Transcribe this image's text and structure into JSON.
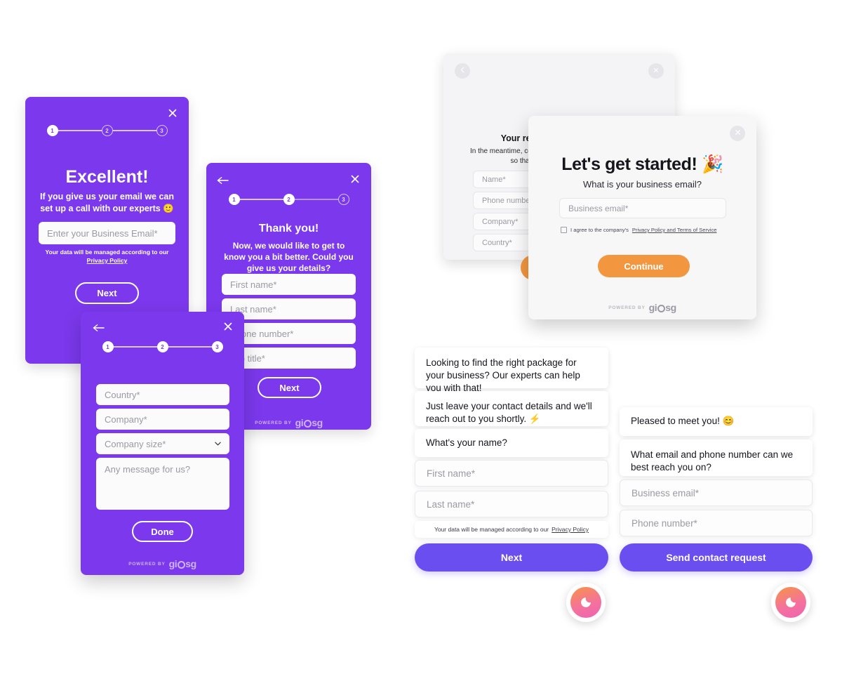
{
  "brand": {
    "purple": "#7b38ec",
    "indigo": "#6b4ef0",
    "orange": "#f2973f",
    "powered_by": "POWERED BY",
    "logo_g1": "gi",
    "logo_g2": "sg"
  },
  "card_excellent": {
    "name": "excellent-card",
    "close_icon": "close-icon",
    "steps": [
      {
        "label": "1",
        "state": "active"
      },
      {
        "label": "2",
        "state": "idle"
      },
      {
        "label": "3",
        "state": "idle"
      }
    ],
    "title": "Excellent!",
    "subtitle": "If you give us your email we can set up a call with our experts 🙂",
    "email_placeholder": "Enter your Business Email*",
    "privacy_text": "Your data will be managed according to our",
    "privacy_link": "Privacy Policy",
    "button_label": "Next"
  },
  "card_thankyou": {
    "name": "thank-you-card",
    "back_icon": "arrow-left-icon",
    "close_icon": "close-icon",
    "steps": [
      {
        "label": "1",
        "state": "active"
      },
      {
        "label": "2",
        "state": "active"
      },
      {
        "label": "3",
        "state": "idle"
      }
    ],
    "title": "Thank you!",
    "subtitle": "Now, we would like to get to know you a bit better. Could you give us your details?",
    "fields": [
      "First name*",
      "Last name*",
      "Phone number*",
      "Job title*"
    ],
    "button_label": "Next"
  },
  "card_details": {
    "name": "company-details-card",
    "back_icon": "arrow-left-icon",
    "close_icon": "close-icon",
    "steps": [
      {
        "label": "1",
        "state": "active"
      },
      {
        "label": "2",
        "state": "active"
      },
      {
        "label": "3",
        "state": "active"
      }
    ],
    "fields": [
      "Country*",
      "Company*"
    ],
    "select_placeholder": "Company size*",
    "select_icon": "chevron-down-icon",
    "textarea_placeholder": "Any message for us?",
    "button_label": "Done"
  },
  "card_request_sent": {
    "name": "request-sent-card",
    "back_icon": "arrow-left-icon",
    "close_icon": "close-icon",
    "title": "Your request has been sent.",
    "subtitle": "In the meantime, could you give us a bit more information so that we can help you better?",
    "fields": [
      "Name*",
      "Phone number*",
      "Company*",
      "Country*"
    ]
  },
  "card_get_started": {
    "name": "get-started-card",
    "close_icon": "close-icon",
    "title": "Let's get started! 🎉",
    "subtitle": "What is your business email?",
    "email_placeholder": "Business email*",
    "consent_text": "I agree to the company's",
    "consent_link": "Privacy Policy and Terms of Service",
    "button_label": "Continue"
  },
  "chat_left": {
    "name": "chat-widget-name-step",
    "close_icon": "close-icon",
    "messages": [
      "Looking to find the right package for your business? Our experts can help you with that!",
      "Just leave your contact details and we'll reach out to you shortly. ⚡",
      "What's your name?"
    ],
    "fields": [
      "First name*",
      "Last name*"
    ],
    "privacy_text": "Your data will be managed according to our",
    "privacy_link": "Privacy Policy",
    "button_label": "Next",
    "launcher_icon": "giosg-chat-launcher-icon"
  },
  "chat_right": {
    "name": "chat-widget-contact-step",
    "close_icon": "close-icon",
    "messages": [
      "Pleased to meet you! 😊",
      "What email and phone number can we best reach you on?"
    ],
    "fields": [
      "Business email*",
      "Phone number*"
    ],
    "button_label": "Send contact request",
    "launcher_icon": "giosg-chat-launcher-icon"
  }
}
